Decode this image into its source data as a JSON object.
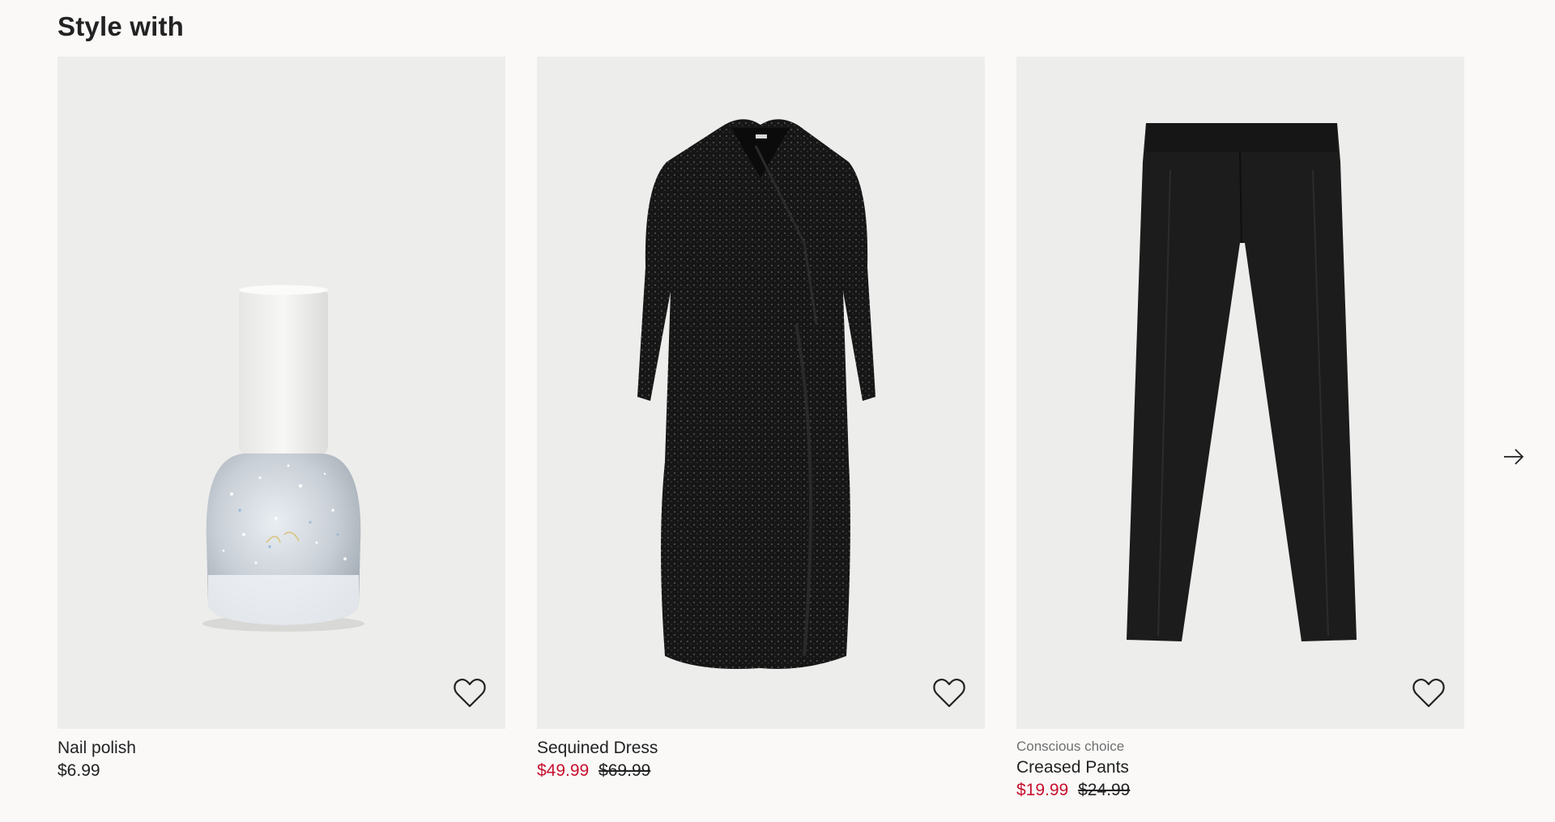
{
  "section": {
    "title": "Style with"
  },
  "products": [
    {
      "name": "Nail polish",
      "price": "$6.99",
      "image_icon": "nail-polish-image",
      "favorite_icon": "heart-icon"
    },
    {
      "name": "Sequined Dress",
      "sale_price": "$49.99",
      "original_price": "$69.99",
      "image_icon": "sequined-dress-image",
      "favorite_icon": "heart-icon"
    },
    {
      "marker": "Conscious choice",
      "name": "Creased Pants",
      "sale_price": "$19.99",
      "original_price": "$24.99",
      "image_icon": "black-pants-image",
      "favorite_icon": "heart-icon"
    }
  ],
  "navigation": {
    "next_icon": "arrow-right-icon"
  },
  "colors": {
    "background": "#faf9f8",
    "image_background": "#ededeb",
    "text": "#222222",
    "sale": "#c8102e",
    "marker": "#707070"
  }
}
